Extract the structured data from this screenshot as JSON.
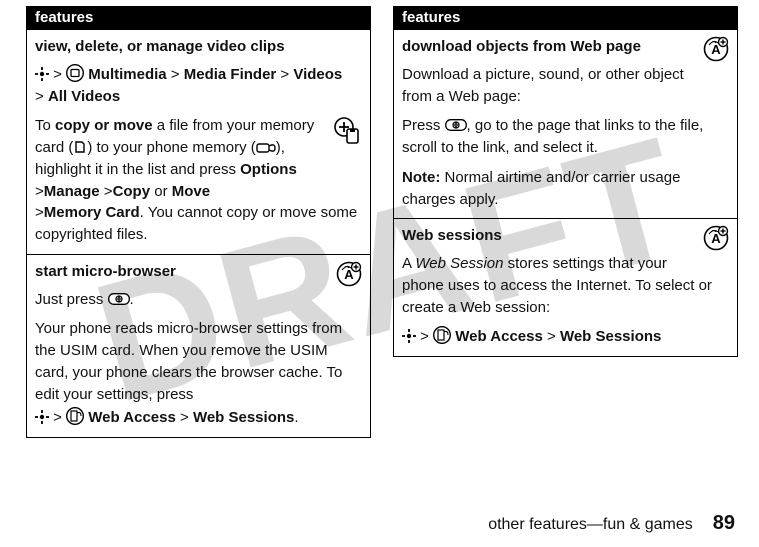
{
  "watermark": "DRAFT",
  "left": {
    "header": "features",
    "cells": [
      {
        "title": "view, delete, or manage video clips",
        "p1_pre": "",
        "nav1": "Multimedia",
        "nav2": "Media Finder",
        "nav3": "Videos",
        "nav4": "All Videos",
        "p2a": "To ",
        "p2b_bold": "copy or move",
        "p2c": " a file from your memory card (",
        "p2d": ") to your phone memory (",
        "p2e": "), highlight it in the list and press ",
        "opt": "Options",
        "mng": "Manage",
        "copy": "Copy",
        "or": " or ",
        "move": "Move",
        "mc": "Memory Card",
        "p2f": ". You cannot copy or move some copyrighted files."
      },
      {
        "title": "start micro-browser",
        "p1": "Just press ",
        "p1b": ".",
        "p2": "Your phone reads micro-browser settings from the USIM card. When you remove the USIM card, your phone clears the browser cache. To edit your settings, press",
        "nav1": "Web Access",
        "nav2": "Web Sessions",
        "navend": "."
      }
    ]
  },
  "right": {
    "header": "features",
    "cells": [
      {
        "title": "download objects from Web page",
        "p1": "Download a picture, sound, or other object from a Web page:",
        "p2a": "Press ",
        "p2b": ", go to the page that links to the file, scroll to the link, and select it.",
        "note_label": "Note:",
        "note_body": " Normal airtime and/or carrier usage charges apply."
      },
      {
        "title": "Web sessions",
        "p1a": "A ",
        "p1b_ital": "Web Session",
        "p1c": " stores settings that your phone uses to access the Internet. To select or create a Web session:",
        "nav1": "Web Access",
        "nav2": "Web Sessions"
      }
    ]
  },
  "footer": {
    "section": "other features—fun & games",
    "page": "89"
  }
}
